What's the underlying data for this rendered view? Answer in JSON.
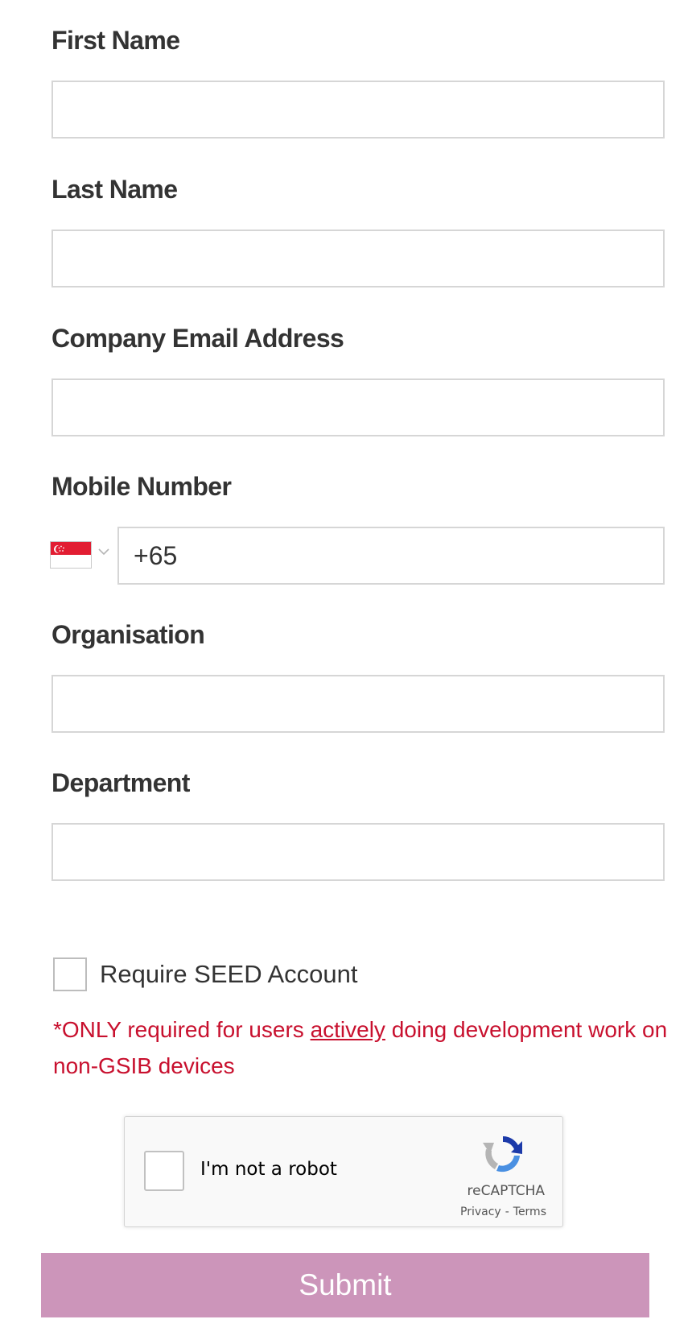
{
  "form": {
    "first_name": {
      "label": "First Name",
      "value": ""
    },
    "last_name": {
      "label": "Last Name",
      "value": ""
    },
    "email": {
      "label": "Company Email Address",
      "value": ""
    },
    "mobile": {
      "label": "Mobile Number",
      "country": "singapore-flag-icon",
      "value": "+65"
    },
    "organisation": {
      "label": "Organisation",
      "value": ""
    },
    "department": {
      "label": "Department",
      "value": ""
    },
    "seed_account": {
      "label": "Require SEED Account",
      "checked": false,
      "note_prefix": "*ONLY required for users ",
      "note_emphasis": "actively",
      "note_suffix": " doing development work on non-GSIB devices"
    }
  },
  "recaptcha": {
    "label": "I'm not a robot",
    "brand": "reCAPTCHA",
    "privacy": "Privacy",
    "separator": "-",
    "terms": "Terms"
  },
  "submit": {
    "label": "Submit"
  },
  "colors": {
    "label_text": "#333333",
    "input_border": "#d6d6d6",
    "note_red": "#c8102e",
    "submit_bg": "#cc95ba",
    "flag_red": "#e21d32"
  }
}
